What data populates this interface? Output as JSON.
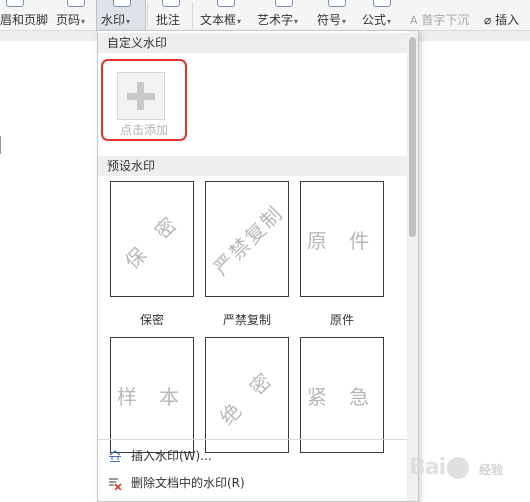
{
  "ribbon": {
    "header_footer": "眉和页脚",
    "page_number": "页码",
    "watermark": "水印",
    "comment": "批注",
    "textbox": "文本框",
    "wordart": "艺术字",
    "symbol": "符号",
    "formula": "公式",
    "dropcap": "首字下沉",
    "insert": "插入",
    "arrow": "▾"
  },
  "menu": {
    "custom_header": "自定义水印",
    "add_label": "点击添加",
    "preset_header": "预设水印",
    "presets": [
      {
        "text": "保 密",
        "label": "保密",
        "tilted": true
      },
      {
        "text": "严禁复制",
        "label": "严禁复制",
        "tilted": true
      },
      {
        "text": "原 件",
        "label": "原件",
        "tilted": false
      },
      {
        "text": "样 本",
        "label": "",
        "tilted": false
      },
      {
        "text": "绝 密",
        "label": "",
        "tilted": true
      },
      {
        "text": "紧 急",
        "label": "",
        "tilted": false
      }
    ],
    "insert_watermark": "插入水印(W)...",
    "remove_watermark": "删除文档中的水印(R)"
  },
  "watermark_logo": {
    "brand": "Bai",
    "sub": "经验"
  },
  "colors": {
    "accent_red": "#e2332f",
    "ribbon_bg": "#f5f5f5",
    "section_bg": "#eeeeee"
  }
}
